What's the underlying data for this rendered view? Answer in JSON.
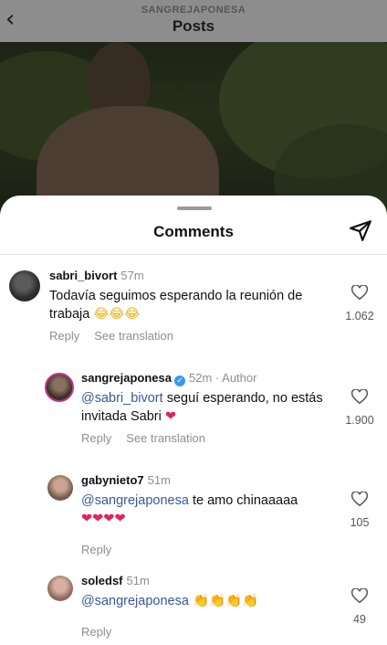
{
  "header": {
    "account": "SANGREJAPONESA",
    "title": "Posts",
    "back_icon": "chevron-left-icon"
  },
  "sheet": {
    "title": "Comments",
    "share_icon": "paper-plane-icon"
  },
  "comments": [
    {
      "username": "sabri_bivort",
      "time": "57m",
      "text": "Todavía seguimos esperando la reunión de trabaja",
      "emoji": "😂😂😂",
      "reply_label": "Reply",
      "translate_label": "See translation",
      "likes": "1.062"
    },
    {
      "username": "sangrejaponesa",
      "verified": true,
      "time": "52m",
      "author_label": "· Author",
      "mention": "@sabri_bivort",
      "text": " seguí esperando, no estás invitada Sabri ",
      "emoji": "❤",
      "reply_label": "Reply",
      "translate_label": "See translation",
      "likes": "1.900"
    },
    {
      "username": "gabynieto7",
      "time": "51m",
      "mention": "@sangrejaponesa",
      "text": " te amo chinaaaaa",
      "emoji": "❤❤❤❤",
      "reply_label": "Reply",
      "likes": "105"
    },
    {
      "username": "soledsf",
      "time": "51m",
      "mention": "@sangrejaponesa",
      "text": " ",
      "emoji": "👏👏👏👏",
      "reply_label": "Reply",
      "likes": "49"
    }
  ],
  "colors": {
    "mention": "#385898",
    "heart": "#e0245e",
    "verified": "#3897f0",
    "secondary_text": "#8e8e8e"
  }
}
